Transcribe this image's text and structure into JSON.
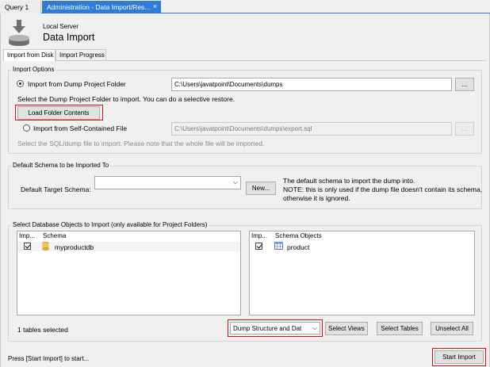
{
  "tabs": [
    {
      "label": "Query 1"
    },
    {
      "label": "Administration - Data Import/Res...",
      "close": "×"
    }
  ],
  "header": {
    "subtitle": "Local Server",
    "title": "Data Import"
  },
  "inner_tabs": [
    {
      "label": "Import from Disk",
      "active": true
    },
    {
      "label": "Import Progress",
      "active": false
    }
  ],
  "import_options": {
    "group_title": "Import Options",
    "dump_folder": {
      "label": "Import from Dump Project Folder",
      "path": "C:\\Users\\javatpoint\\Documents\\dumps",
      "browse": "...",
      "hint": "Select the Dump Project Folder to import. You can do a selective restore.",
      "load_button": "Load Folder Contents"
    },
    "self_contained": {
      "label": "Import from Self-Contained File",
      "path": "C:\\Users\\javatpoint\\Documents\\dumps\\export.sql",
      "browse": "...",
      "hint": "Select the SQL/dump file to import. Please note that the whole file will be imported."
    }
  },
  "default_schema": {
    "group_title": "Default Schema to be Imported To",
    "label": "Default Target Schema:",
    "value": "",
    "new_button": "New...",
    "note_line1": "The default schema to import the dump into.",
    "note_line2": "NOTE: this is only used if the dump file doesn't contain its schema,",
    "note_line3": "otherwise it is ignored."
  },
  "db_objects": {
    "group_title": "Select Database Objects to Import (only available for Project Folders)",
    "left_list": {
      "headers": [
        "Imp...",
        "Schema"
      ],
      "rows": [
        {
          "name": "myproductdb"
        }
      ]
    },
    "right_list": {
      "headers": [
        "Imp...",
        "Schema Objects"
      ],
      "rows": [
        {
          "name": "product"
        }
      ]
    },
    "selected_count": "1 tables selected",
    "dump_mode": "Dump Structure and Dat",
    "select_views": "Select Views",
    "select_tables": "Select Tables",
    "unselect_all": "Unselect All"
  },
  "footer": {
    "status": "Press [Start Import] to start...",
    "start_button": "Start Import"
  },
  "colors": {
    "active_tab": "#2f7bd6",
    "highlight_box": "#d0101a",
    "background": "#f0f0f0"
  }
}
